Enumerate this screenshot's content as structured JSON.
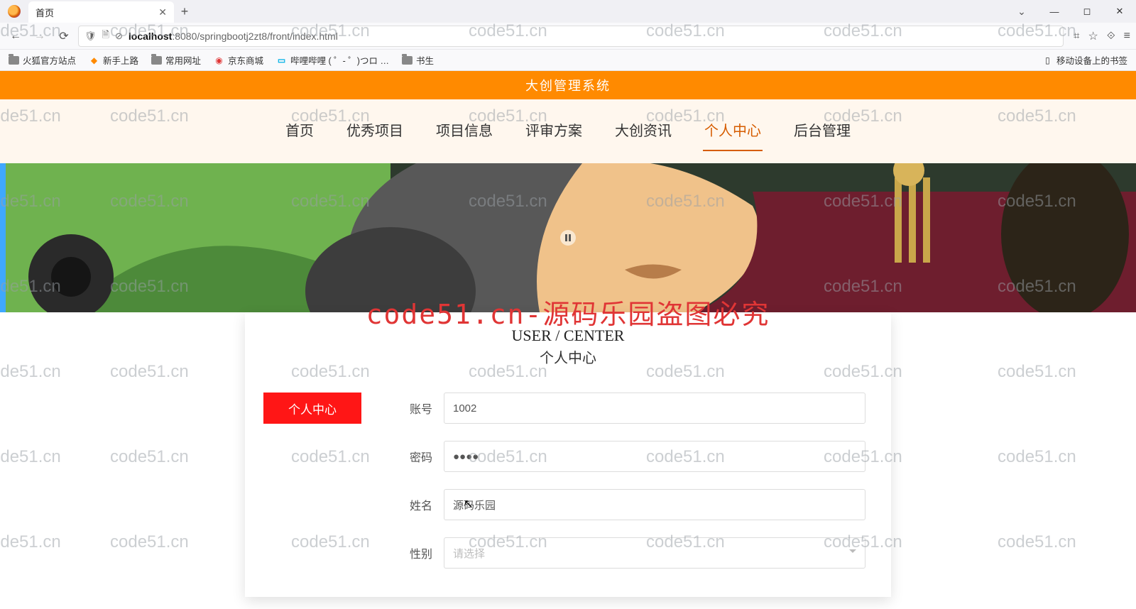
{
  "browser": {
    "tab_title": "首页",
    "url_host": "localhost",
    "url_port_path": ":8080/springbootj2zt8/front/index.html",
    "bookmarks": [
      "火狐官方站点",
      "新手上路",
      "常用网址",
      "京东商城",
      "哔哩哔哩 (  ゜- ゜)つロ …",
      "书生"
    ],
    "mobile_bookmark": "移动设备上的书签"
  },
  "header": {
    "system_title": "大创管理系统"
  },
  "nav": {
    "items": [
      "首页",
      "优秀项目",
      "项目信息",
      "评审方案",
      "大创资讯",
      "个人中心",
      "后台管理"
    ],
    "active_index": 5
  },
  "card": {
    "title_en": "USER / CENTER",
    "title_cn": "个人中心",
    "side_tab": "个人中心"
  },
  "form": {
    "labels": {
      "account": "账号",
      "password": "密码",
      "name": "姓名",
      "gender": "性别"
    },
    "values": {
      "account": "1002",
      "password": "●●●●",
      "name": "源码乐园"
    },
    "gender_placeholder": "请选择"
  },
  "watermark": {
    "small": "code51.cn",
    "big": "code51.cn-源码乐园盗图必究"
  }
}
